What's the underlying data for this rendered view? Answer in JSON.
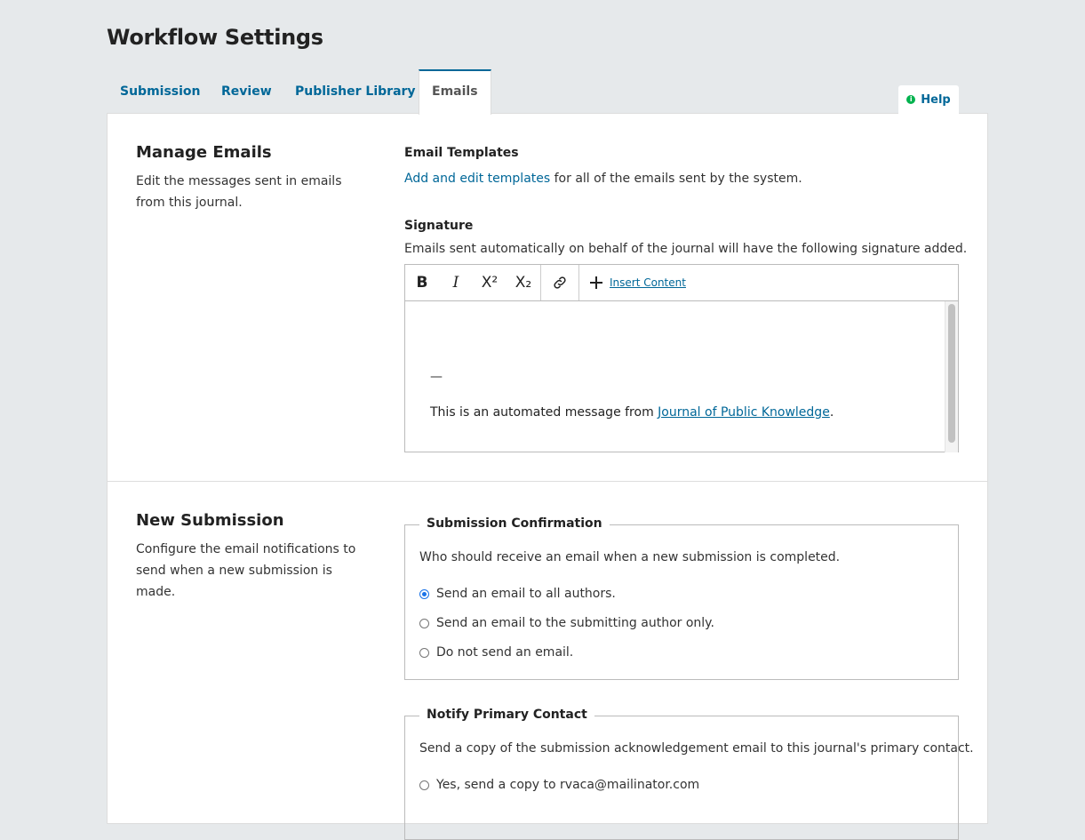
{
  "page": {
    "title": "Workflow Settings"
  },
  "tabs": [
    {
      "label": "Submission"
    },
    {
      "label": "Review"
    },
    {
      "label": "Publisher Library"
    },
    {
      "label": "Emails"
    }
  ],
  "help": {
    "label": "Help",
    "icon": "info-icon"
  },
  "manage_emails": {
    "heading": "Manage Emails",
    "description": "Edit the messages sent in emails from this journal.",
    "templates": {
      "label": "Email Templates",
      "link_text": "Add and edit templates",
      "suffix_text": " for all of the emails sent by the system."
    },
    "signature": {
      "label": "Signature",
      "description": "Emails sent automatically on behalf of the journal will have the following signature added.",
      "toolbar": {
        "bold": "B",
        "italic": "I",
        "superscript": "X²",
        "subscript": "X₂",
        "insert_content": "Insert Content"
      },
      "content": {
        "dash": "—",
        "prefix": "This is an automated message from ",
        "link_text": "Journal of Public Knowledge",
        "suffix": "."
      }
    }
  },
  "new_submission": {
    "heading": "New Submission",
    "description": "Configure the email notifications to send when a new submission is made.",
    "confirmation": {
      "legend": "Submission Confirmation",
      "question": "Who should receive an email when a new submission is completed.",
      "options": [
        {
          "label": "Send an email to all authors.",
          "checked": true
        },
        {
          "label": "Send an email to the submitting author only.",
          "checked": false
        },
        {
          "label": "Do not send an email.",
          "checked": false
        }
      ]
    },
    "primary_contact": {
      "legend": "Notify Primary Contact",
      "question": "Send a copy of the submission acknowledgement email to this journal's primary contact.",
      "options": [
        {
          "label": "Yes, send a copy to rvaca@mailinator.com",
          "checked": false
        }
      ]
    }
  }
}
